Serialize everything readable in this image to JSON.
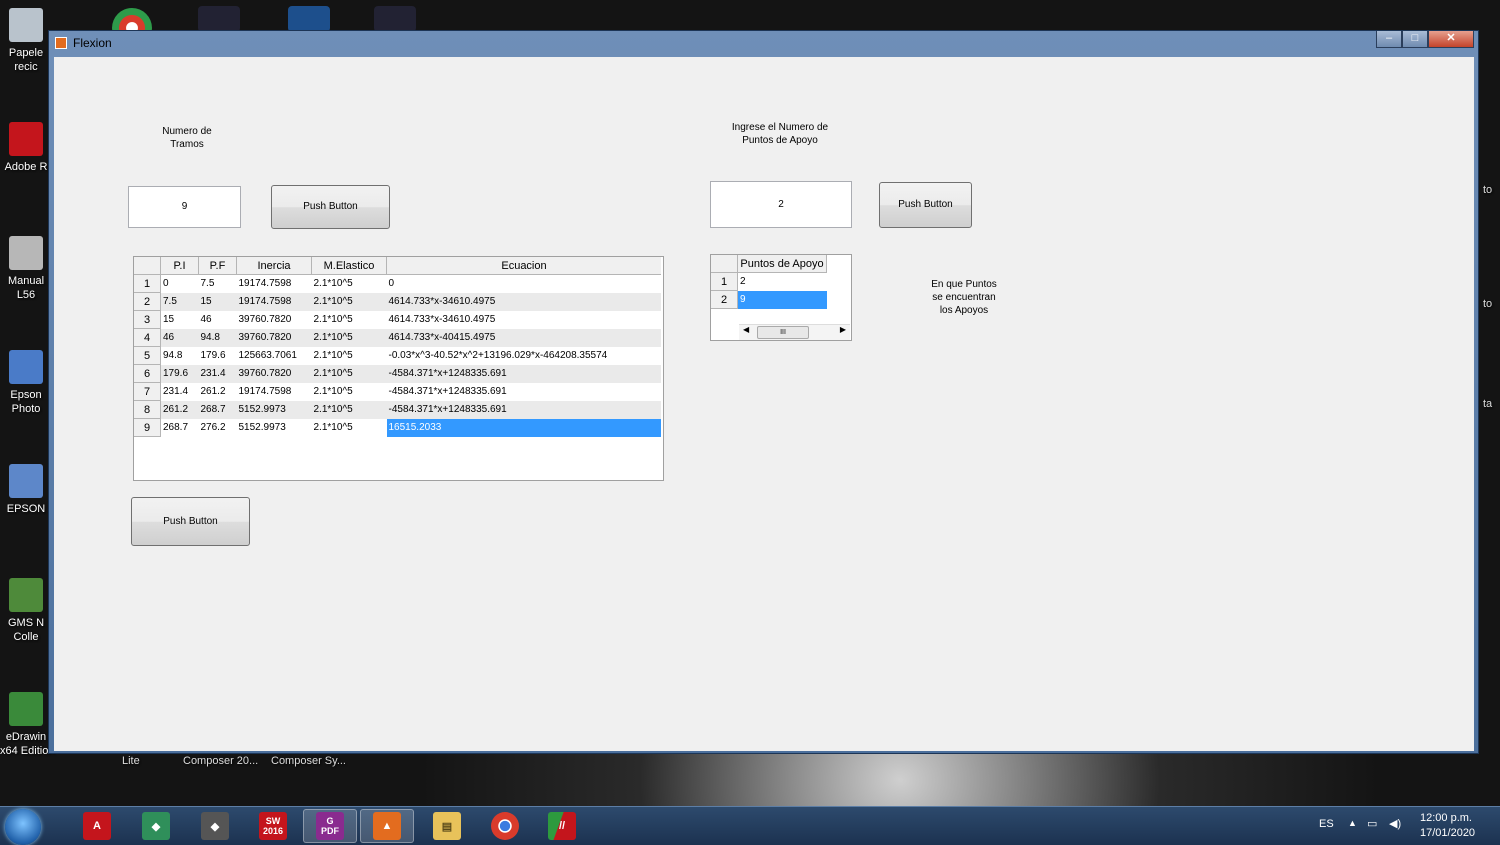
{
  "desktop": {
    "icons": [
      {
        "label": "Papele\nrecic",
        "color": "#b9c3cc"
      },
      {
        "label": "Adobe R",
        "color": "#c4151c"
      },
      {
        "label": "Manual\nL56",
        "color": "#b7b7b7"
      },
      {
        "label": "Epson\nPhoto",
        "color": "#4a7bc8"
      },
      {
        "label": "EPSON",
        "color": "#5d87c9"
      },
      {
        "label": "GMS N\nColle",
        "color": "#4e8a3a"
      },
      {
        "label": "eDrawin\nx64 Edition",
        "color": "#3a8a3a"
      }
    ],
    "bottom_labels": [
      "Lite",
      "Composer 20...",
      "Composer Sy..."
    ],
    "right_edge_labels": [
      "to",
      "to",
      "ta"
    ]
  },
  "window": {
    "title": "Flexion",
    "controls": {
      "minimize": "–",
      "maximize": "□",
      "close": "✕"
    }
  },
  "form": {
    "tramos_label": "Numero de\nTramos",
    "tramos_value": "9",
    "tramos_button": "Push Button",
    "apoyo_label": "Ingrese el Numero de\nPuntos de Apoyo",
    "apoyo_value": "2",
    "apoyo_button": "Push Button",
    "bottom_button": "Push Button",
    "apoyos_text": "En que Puntos\nse encuentran\nlos Apoyos"
  },
  "tramos_table": {
    "columns": [
      "P.I",
      "P.F",
      "Inercia",
      "M.Elastico",
      "Ecuacion"
    ],
    "rows": [
      {
        "n": "1",
        "cells": [
          "0",
          "7.5",
          "19174.7598",
          "2.1*10^5",
          "0"
        ]
      },
      {
        "n": "2",
        "cells": [
          "7.5",
          "15",
          "19174.7598",
          "2.1*10^5",
          "4614.733*x-34610.4975"
        ]
      },
      {
        "n": "3",
        "cells": [
          "15",
          "46",
          "39760.7820",
          "2.1*10^5",
          "4614.733*x-34610.4975"
        ]
      },
      {
        "n": "4",
        "cells": [
          "46",
          "94.8",
          "39760.7820",
          "2.1*10^5",
          "4614.733*x-40415.4975"
        ]
      },
      {
        "n": "5",
        "cells": [
          "94.8",
          "179.6",
          "125663.7061",
          "2.1*10^5",
          "-0.03*x^3-40.52*x^2+13196.029*x-464208.35574"
        ]
      },
      {
        "n": "6",
        "cells": [
          "179.6",
          "231.4",
          "39760.7820",
          "2.1*10^5",
          "-4584.371*x+1248335.691"
        ]
      },
      {
        "n": "7",
        "cells": [
          "231.4",
          "261.2",
          "19174.7598",
          "2.1*10^5",
          "-4584.371*x+1248335.691"
        ]
      },
      {
        "n": "8",
        "cells": [
          "261.2",
          "268.7",
          "5152.9973",
          "2.1*10^5",
          "-4584.371*x+1248335.691"
        ]
      },
      {
        "n": "9",
        "cells": [
          "268.7",
          "276.2",
          "5152.9973",
          "2.1*10^5",
          "16515.2033"
        ]
      }
    ]
  },
  "apoyo_table": {
    "columns": [
      "Puntos de Apoyo"
    ],
    "rows": [
      {
        "n": "1",
        "cells": [
          "2"
        ]
      },
      {
        "n": "2",
        "cells": [
          "9"
        ]
      }
    ],
    "scroll_thumb": "III"
  },
  "taskbar": {
    "apps": [
      {
        "name": "autocad",
        "label": "A",
        "color": "#c4151c"
      },
      {
        "name": "edrawings",
        "label": "◆",
        "color": "#2f8f5a"
      },
      {
        "name": "composer",
        "label": "◆",
        "color": "#555"
      },
      {
        "name": "solidworks",
        "label": "SW\n2016",
        "color": "#c4151c"
      },
      {
        "name": "pdf-creator",
        "label": "G\nPDF",
        "color": "#8a2b8f"
      },
      {
        "name": "matlab",
        "label": "▲",
        "color": "#e36c1f"
      },
      {
        "name": "explorer",
        "label": "▤",
        "color": "#e8c25a"
      },
      {
        "name": "chrome",
        "label": "●",
        "color": "#d93b2b"
      },
      {
        "name": "app-stripes",
        "label": "//",
        "color": "#2d9a3e"
      }
    ],
    "language": "ES",
    "time": "12:00 p.m.",
    "date": "17/01/2020"
  }
}
